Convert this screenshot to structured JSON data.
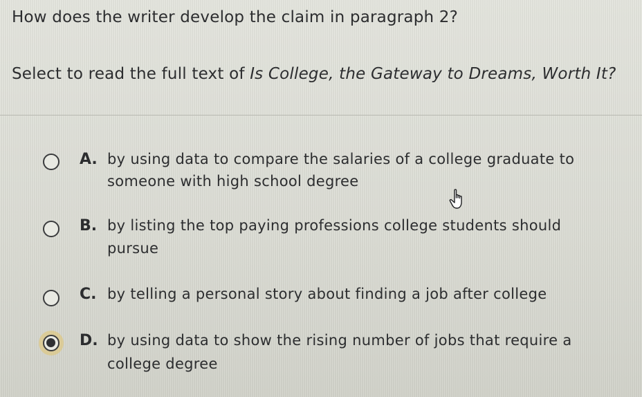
{
  "question": "How does the writer develop the claim in paragraph 2?",
  "prompt": {
    "prefix": "Select to read the full text of ",
    "title": "Is College, the Gateway to Dreams, Worth It?"
  },
  "choices": [
    {
      "letter": "A.",
      "line1": "by using data to compare the salaries of a college graduate to",
      "line2": "someone with high school degree",
      "selected": false
    },
    {
      "letter": "B.",
      "line1": "by listing the top paying professions college students should",
      "line2": "pursue",
      "selected": false
    },
    {
      "letter": "C.",
      "line1": "by telling a personal story about finding a job after college",
      "line2": "",
      "selected": false
    },
    {
      "letter": "D.",
      "line1": "by using data to show the rising number of jobs that require a",
      "line2": "college degree",
      "selected": true
    }
  ],
  "colors": {
    "background": "#dedfd7",
    "text": "#2c2d2f",
    "selection_highlight": "#e2c46e"
  },
  "icons": {
    "cursor": "hand-pointer-icon",
    "radio_empty": "radio-unselected-icon",
    "radio_filled": "radio-selected-icon"
  }
}
